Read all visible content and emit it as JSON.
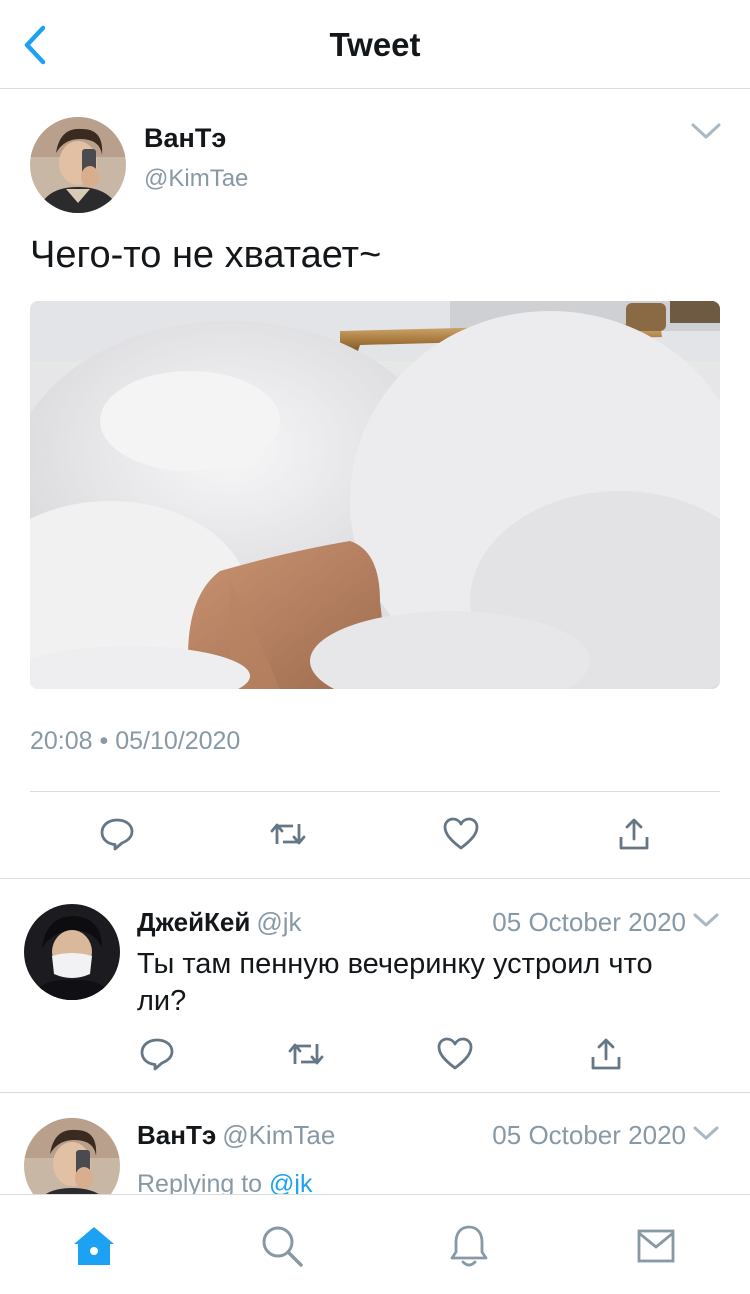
{
  "header": {
    "title": "Tweet",
    "back_icon": "chevron-left-icon"
  },
  "colors": {
    "accent": "#1da1f2",
    "secondary_text": "#8899a6",
    "icon_gray": "#657786",
    "divider": "#d9dde1"
  },
  "main_tweet": {
    "author_name": "ВанТэ",
    "author_handle": "@KimTae",
    "text": "Чего-то не хватает~",
    "timestamp": "20:08 • 05/10/2020",
    "actions": [
      "reply-icon",
      "retweet-icon",
      "like-icon",
      "share-icon"
    ]
  },
  "replies": [
    {
      "author_name": "ДжейКей",
      "author_handle": "@jk",
      "date": "05 October 2020",
      "text": "Ты там пенную вечеринку устроил что ли?"
    },
    {
      "author_name": "ВанТэ",
      "author_handle": "@KimTae",
      "date": "05 October 2020",
      "replying_prefix": "Replying to",
      "replying_mention": "@jk"
    }
  ],
  "tabbar": {
    "items": [
      "home-icon",
      "search-icon",
      "notifications-icon",
      "messages-icon"
    ],
    "active": "home-icon"
  }
}
